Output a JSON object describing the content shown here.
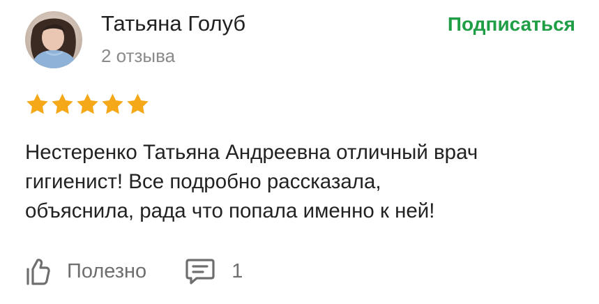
{
  "review": {
    "author": {
      "name": "Татьяна Голуб",
      "reviews_count": "2 отзыва",
      "avatar_icon": "user-photo-avatar"
    },
    "subscribe_label": "Подписаться",
    "rating": {
      "value": 5,
      "max": 5,
      "star_icon": "star-icon"
    },
    "text_lines": [
      "Нестеренко Татьяна Андреевна отличный врач",
      "гигиенист! Все подробно рассказала,",
      "объяснила, рада что попала именно к ней!"
    ],
    "actions": {
      "useful_label": "Полезно",
      "useful_icon": "thumbs-up-icon",
      "comments_icon": "comment-icon",
      "comments_count": "1"
    }
  },
  "colors": {
    "accent_green": "#1f9e46",
    "star_gold": "#f5a818",
    "text_main": "#222222",
    "text_muted": "#8a8a8a",
    "icon_gray": "#6e6e6e"
  }
}
